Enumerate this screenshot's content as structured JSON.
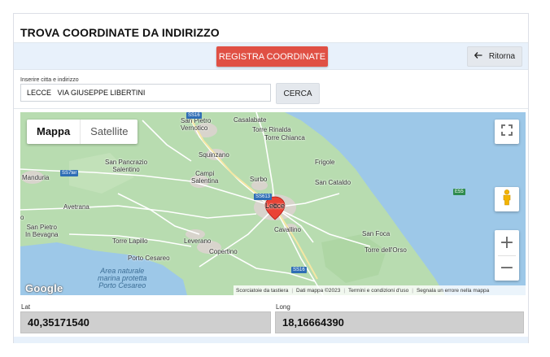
{
  "page": {
    "title": "TROVA COORDINATE DA INDIRIZZO"
  },
  "toolbar": {
    "register_label": "REGISTRA COORDINATE",
    "back_label": "Ritorna",
    "back_icon": "arrow-left-icon"
  },
  "search": {
    "label": "Inserire citta e indirizzo",
    "value": "LECCE   VIA GIUSEPPE LIBERTINI",
    "button_label": "CERCA"
  },
  "map": {
    "maptype": {
      "map_label": "Mappa",
      "satellite_label": "Satellite",
      "selected": "Mappa"
    },
    "places": {
      "casalabate": "Casalabate",
      "san_pietro_vernotico": "San Pietro\nVernotico",
      "torre_rinalda": "Torre Rinalda",
      "torre_chianca": "Torre Chianca",
      "squinzano": "Squinzano",
      "san_pancrazio": "San Pancrazio\nSalentino",
      "frigole": "Frigole",
      "manduria": "Manduria",
      "campi": "Campi\nSalentina",
      "surbo": "Surbo",
      "san_cataldo": "San Cataldo",
      "avetrana": "Avetrana",
      "lecce": "Lecce",
      "cavallino": "Cavallino",
      "san_pietro_bevagna": "San Pietro\nIn Bevagna",
      "san_foca": "San Foca",
      "torre_lapillo": "Torre Lapillo",
      "leverano": "Leverano",
      "torre_orso": "Torre dell'Orso",
      "copertino": "Copertino",
      "porto_cesareo": "Porto Cesareo",
      "area_naturale": "Area naturale\nmarina protetta\nPorto Cesareo",
      "o": "o"
    },
    "road_badges": {
      "ss16_top": "SS16",
      "ss7ter": "SS7ter",
      "ss613": "SS613",
      "e55": "E55",
      "ss16_bottom": "SS16"
    },
    "attribution": {
      "shortcuts": "Scorciatoie da tastiera",
      "data": "Dati mappa ©2023",
      "terms": "Termini e condizioni d'uso",
      "report": "Segnala un errore nella mappa"
    },
    "logo_text": "Google",
    "zoom_in": "+",
    "zoom_out": "−"
  },
  "coords": {
    "lat_label": "Lat",
    "lat_value": "40,35171540",
    "long_label": "Long",
    "long_value": "18,16664390"
  },
  "colors": {
    "accent": "#e05044",
    "toolbar_bg": "#e8f1fb",
    "land": "#b8dcb0",
    "sea": "#9dc8e8",
    "pin": "#ea4335"
  }
}
